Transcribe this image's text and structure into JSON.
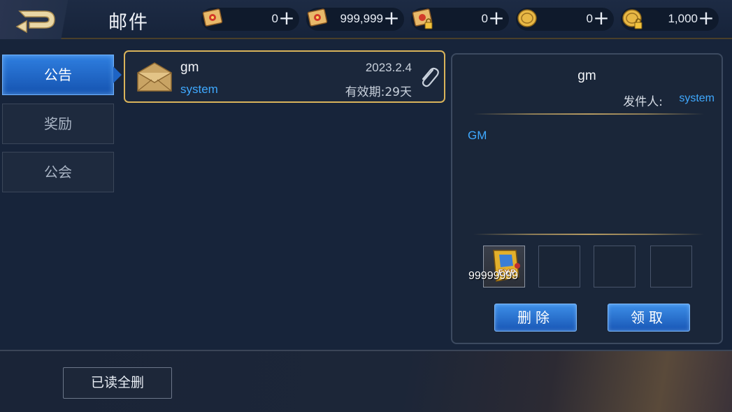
{
  "header": {
    "title": "邮件",
    "currencies": [
      {
        "icon": "scroll-ticket-icon",
        "value": "0"
      },
      {
        "icon": "scroll-ticket-icon",
        "value": "999,999"
      },
      {
        "icon": "locked-scroll-ticket-icon",
        "value": "0"
      },
      {
        "icon": "gold-coin-icon",
        "value": "0"
      },
      {
        "icon": "locked-gold-coin-icon",
        "value": "1,000"
      }
    ],
    "plus_label": "+"
  },
  "tabs": [
    {
      "label": "公告",
      "active": true
    },
    {
      "label": "奖励",
      "active": false
    },
    {
      "label": "公会",
      "active": false
    }
  ],
  "mail_list": [
    {
      "title": "gm",
      "sender": "system",
      "date": "2023.2.4",
      "expiry": "有效期:29天",
      "has_attachment": true
    }
  ],
  "detail": {
    "title": "gm",
    "sender_label": "发件人:",
    "sender": "system",
    "body": "GM",
    "attachments": [
      {
        "icon": "exp-card-icon",
        "quantity": "99999999"
      }
    ],
    "delete_label": "删除",
    "claim_label": "领取"
  },
  "footer": {
    "delete_read_label": "已读全删"
  },
  "colors": {
    "accent_blue": "#3fa9ff",
    "gold_border": "#d9b35a",
    "active_tab": "#1e64c4"
  }
}
